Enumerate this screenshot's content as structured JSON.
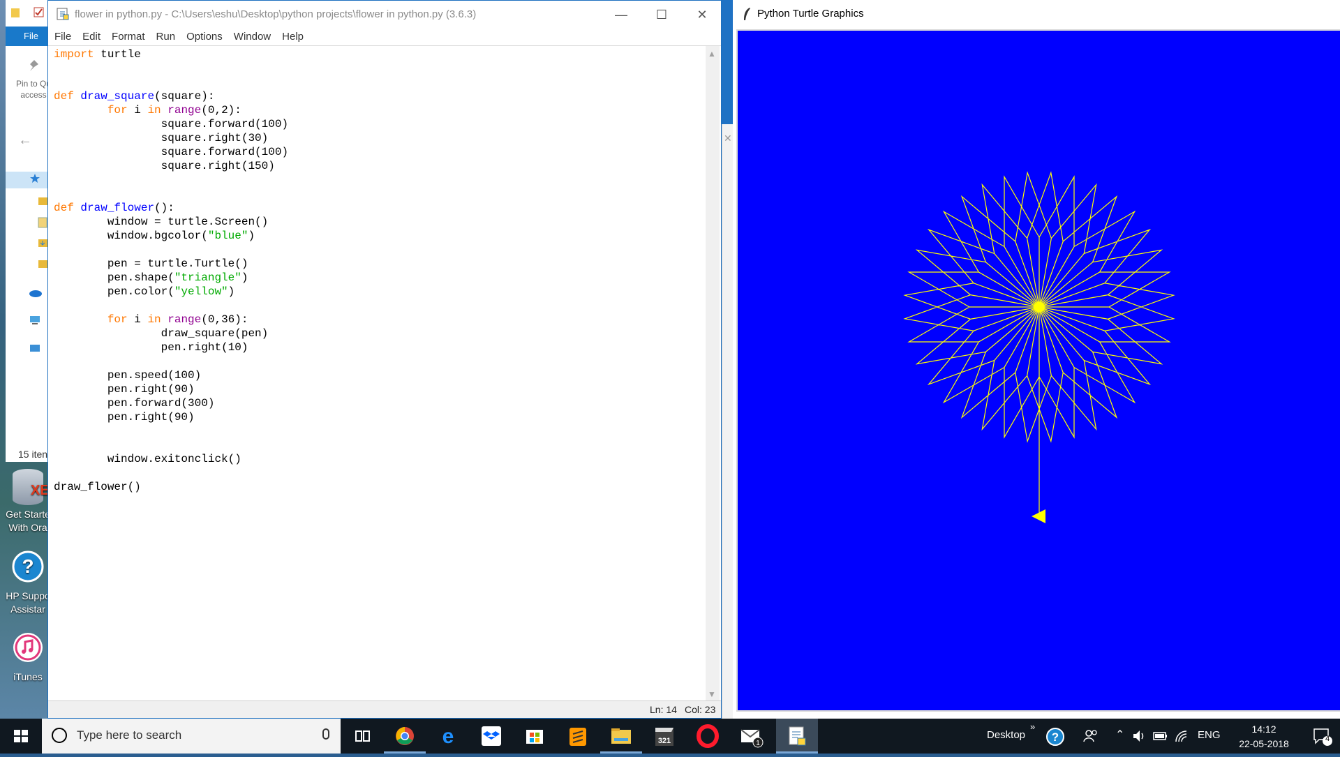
{
  "explorer": {
    "ribbon_tab": "File",
    "pin_label_1": "Pin to Qu",
    "pin_label_2": "access",
    "item_count": "15 iten"
  },
  "desktop_icons": [
    {
      "line1": "Get Starte",
      "line2": "With Ora"
    },
    {
      "line1": "HP Suppo",
      "line2": "Assistar"
    },
    {
      "line1": "iTunes",
      "line2": ""
    }
  ],
  "idle": {
    "title": "flower in python.py - C:\\Users\\eshu\\Desktop\\python projects\\flower in python.py (3.6.3)",
    "menu": [
      "File",
      "Edit",
      "Format",
      "Run",
      "Options",
      "Window",
      "Help"
    ],
    "code_lines": [
      [
        {
          "t": "import",
          "c": "kw"
        },
        {
          "t": " turtle",
          "c": ""
        }
      ],
      [],
      [],
      [
        {
          "t": "def",
          "c": "kw"
        },
        {
          "t": " ",
          "c": ""
        },
        {
          "t": "draw_square",
          "c": "fn"
        },
        {
          "t": "(square):",
          "c": ""
        }
      ],
      [
        {
          "t": "        ",
          "c": ""
        },
        {
          "t": "for",
          "c": "kw"
        },
        {
          "t": " i ",
          "c": ""
        },
        {
          "t": "in",
          "c": "kw"
        },
        {
          "t": " ",
          "c": ""
        },
        {
          "t": "range",
          "c": "bi"
        },
        {
          "t": "(0,2):",
          "c": ""
        }
      ],
      [
        {
          "t": "                square.forward(100)",
          "c": ""
        }
      ],
      [
        {
          "t": "                square.right(30)",
          "c": ""
        }
      ],
      [
        {
          "t": "                square.forward(100)",
          "c": ""
        }
      ],
      [
        {
          "t": "                square.right(150)",
          "c": ""
        }
      ],
      [],
      [],
      [
        {
          "t": "def",
          "c": "kw"
        },
        {
          "t": " ",
          "c": ""
        },
        {
          "t": "draw_flower",
          "c": "fn"
        },
        {
          "t": "():",
          "c": ""
        }
      ],
      [
        {
          "t": "        window = turtle.Screen()",
          "c": ""
        }
      ],
      [
        {
          "t": "        window.bgcolor(",
          "c": ""
        },
        {
          "t": "\"blue\"",
          "c": "st"
        },
        {
          "t": ")",
          "c": ""
        }
      ],
      [],
      [
        {
          "t": "        pen = turtle.Turtle()",
          "c": ""
        }
      ],
      [
        {
          "t": "        pen.shape(",
          "c": ""
        },
        {
          "t": "\"triangle\"",
          "c": "st"
        },
        {
          "t": ")",
          "c": ""
        }
      ],
      [
        {
          "t": "        pen.color(",
          "c": ""
        },
        {
          "t": "\"yellow\"",
          "c": "st"
        },
        {
          "t": ")",
          "c": ""
        }
      ],
      [],
      [
        {
          "t": "        ",
          "c": ""
        },
        {
          "t": "for",
          "c": "kw"
        },
        {
          "t": " i ",
          "c": ""
        },
        {
          "t": "in",
          "c": "kw"
        },
        {
          "t": " ",
          "c": ""
        },
        {
          "t": "range",
          "c": "bi"
        },
        {
          "t": "(0,36):",
          "c": ""
        }
      ],
      [
        {
          "t": "                draw_square(pen)",
          "c": ""
        }
      ],
      [
        {
          "t": "                pen.right(10)",
          "c": ""
        }
      ],
      [],
      [
        {
          "t": "        pen.speed(100)",
          "c": ""
        }
      ],
      [
        {
          "t": "        pen.right(90)",
          "c": ""
        }
      ],
      [
        {
          "t": "        pen.forward(300)",
          "c": ""
        }
      ],
      [
        {
          "t": "        pen.right(90)",
          "c": ""
        }
      ],
      [],
      [],
      [
        {
          "t": "        window.exitonclick()",
          "c": ""
        }
      ],
      [],
      [
        {
          "t": "draw_flower()",
          "c": ""
        }
      ]
    ],
    "status_line": "Ln: 14",
    "status_col": "Col: 23"
  },
  "turtle": {
    "title": "Python Turtle Graphics",
    "bgcolor": "#0000ff",
    "pen_color": "#ffff00",
    "petals": 36,
    "petal_turn_deg": 10,
    "square_reps": 2,
    "side_length": 100,
    "inner_turn_deg": 30,
    "outer_turn_deg": 150,
    "stem_length": 300,
    "turtle_shape": "triangle"
  },
  "taskbar": {
    "search_placeholder": "Type here to search",
    "apps": [
      "task-view",
      "chrome",
      "edge",
      "dropbox",
      "store",
      "sublime-text",
      "file-explorer",
      "calendar-321",
      "opera",
      "mail",
      "python-idle"
    ],
    "desktop_label": "Desktop",
    "language": "ENG",
    "time": "14:12",
    "date": "22-05-2018",
    "notification_count": "4"
  }
}
